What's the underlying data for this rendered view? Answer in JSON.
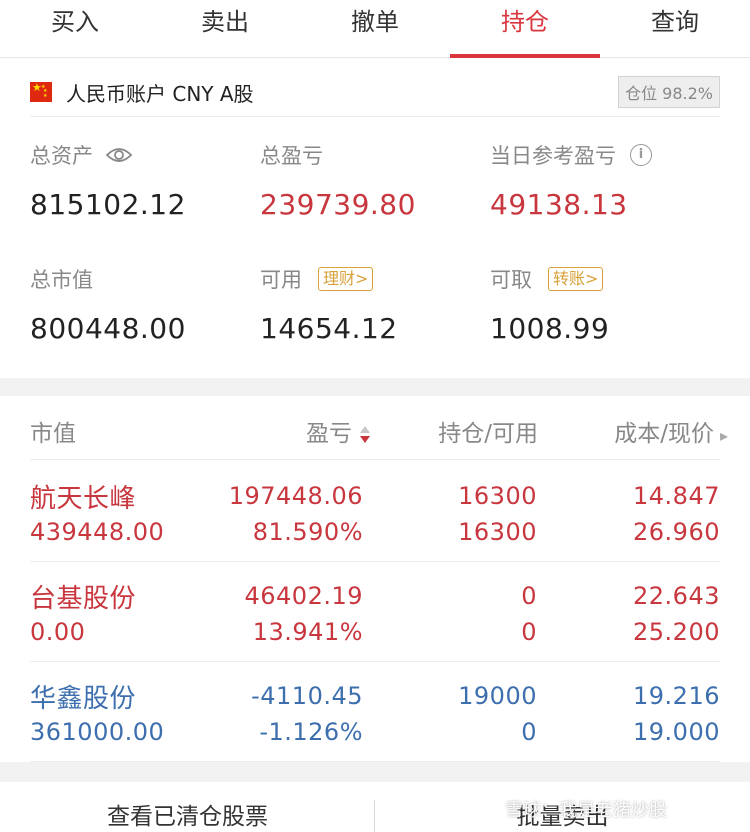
{
  "tabs": [
    {
      "label": "买入"
    },
    {
      "label": "卖出"
    },
    {
      "label": "撤单"
    },
    {
      "label": "持仓"
    },
    {
      "label": "查询"
    }
  ],
  "active_tab": "持仓",
  "account": {
    "name": "人民币账户 CNY A股",
    "position_label": "仓位 98.2%"
  },
  "summary": {
    "total_assets": {
      "label": "总资产",
      "value": "815102.12"
    },
    "total_pnl": {
      "label": "总盈亏",
      "value": "239739.80"
    },
    "day_pnl": {
      "label": "当日参考盈亏",
      "value": "49138.13"
    },
    "market_value": {
      "label": "总市值",
      "value": "800448.00"
    },
    "available": {
      "label": "可用",
      "value": "14654.12",
      "tag": "理财>"
    },
    "withdrawable": {
      "label": "可取",
      "value": "1008.99",
      "tag": "转账>"
    }
  },
  "holdings_header": {
    "market_value": "市值",
    "pnl": "盈亏",
    "position": "持仓/可用",
    "cost_price": "成本/现价"
  },
  "holdings": [
    {
      "name": "航天长峰",
      "market_value": "439448.00",
      "pnl": "197448.06",
      "pnl_pct": "81.590%",
      "position": "16300",
      "available": "16300",
      "cost": "14.847",
      "price": "26.960"
    },
    {
      "name": "台基股份",
      "market_value": "0.00",
      "pnl": "46402.19",
      "pnl_pct": "13.941%",
      "position": "0",
      "available": "0",
      "cost": "22.643",
      "price": "25.200"
    },
    {
      "name": "华鑫股份",
      "market_value": "361000.00",
      "pnl": "-4110.45",
      "pnl_pct": "-1.126%",
      "position": "19000",
      "available": "0",
      "cost": "19.216",
      "price": "19.000"
    }
  ],
  "bottom": {
    "cleared_stocks": "查看已清仓股票",
    "batch_sell": "批量卖出"
  },
  "watermark": "雪球：我是老猪炒股",
  "colors": {
    "accent": "#d9363e",
    "gain": "#c8363e",
    "loss": "#3d6fae",
    "tag": "#d8a13a"
  }
}
